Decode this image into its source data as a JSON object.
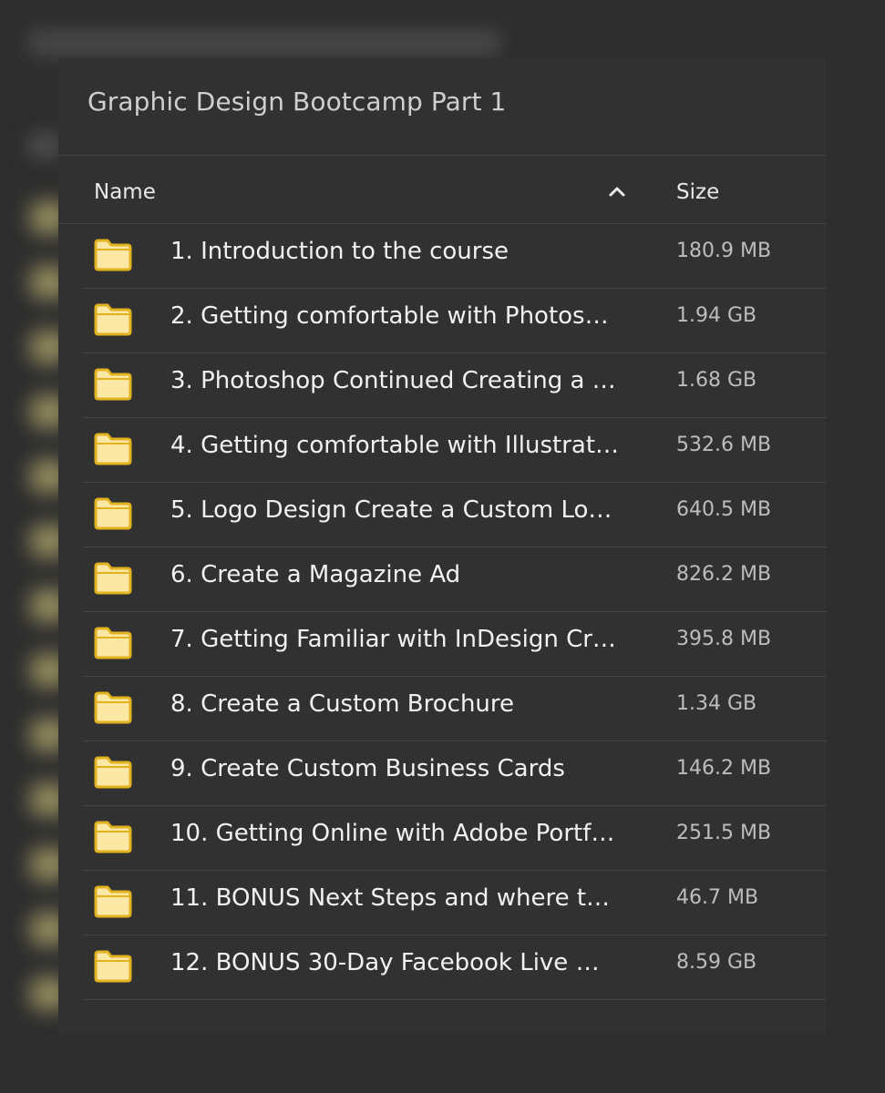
{
  "window": {
    "title": "Graphic Design Bootcamp Part 1"
  },
  "table": {
    "headers": {
      "name": "Name",
      "size": "Size"
    },
    "sort": {
      "column": "name",
      "direction": "ascending",
      "icon": "chevron-up-icon"
    },
    "rows": [
      {
        "name": "1. Introduction to the course",
        "size": "180.9 MB",
        "icon": "folder-icon"
      },
      {
        "name": "2. Getting comfortable with Photos…",
        "size": "1.94 GB",
        "icon": "folder-icon"
      },
      {
        "name": "3. Photoshop Continued Creating a …",
        "size": "1.68 GB",
        "icon": "folder-icon"
      },
      {
        "name": "4. Getting comfortable with Illustrat…",
        "size": "532.6 MB",
        "icon": "folder-icon"
      },
      {
        "name": "5. Logo Design Create a Custom Lo…",
        "size": "640.5 MB",
        "icon": "folder-icon"
      },
      {
        "name": "6. Create a Magazine Ad",
        "size": "826.2 MB",
        "icon": "folder-icon"
      },
      {
        "name": "7. Getting Familiar with InDesign Cr…",
        "size": "395.8 MB",
        "icon": "folder-icon"
      },
      {
        "name": "8. Create a Custom Brochure",
        "size": "1.34 GB",
        "icon": "folder-icon"
      },
      {
        "name": "9. Create Custom Business Cards",
        "size": "146.2 MB",
        "icon": "folder-icon"
      },
      {
        "name": "10. Getting Online with Adobe Portf…",
        "size": "251.5 MB",
        "icon": "folder-icon"
      },
      {
        "name": "11. BONUS Next Steps and where t…",
        "size": "46.7 MB",
        "icon": "folder-icon"
      },
      {
        "name": "12. BONUS 30-Day Facebook Live …",
        "size": "8.59 GB",
        "icon": "folder-icon"
      }
    ]
  },
  "colors": {
    "background": "#2d2d2d",
    "panel": "#313131",
    "folder_fill": "#fbe8a4",
    "folder_stroke": "#e3b21f",
    "divider": "#454545"
  }
}
